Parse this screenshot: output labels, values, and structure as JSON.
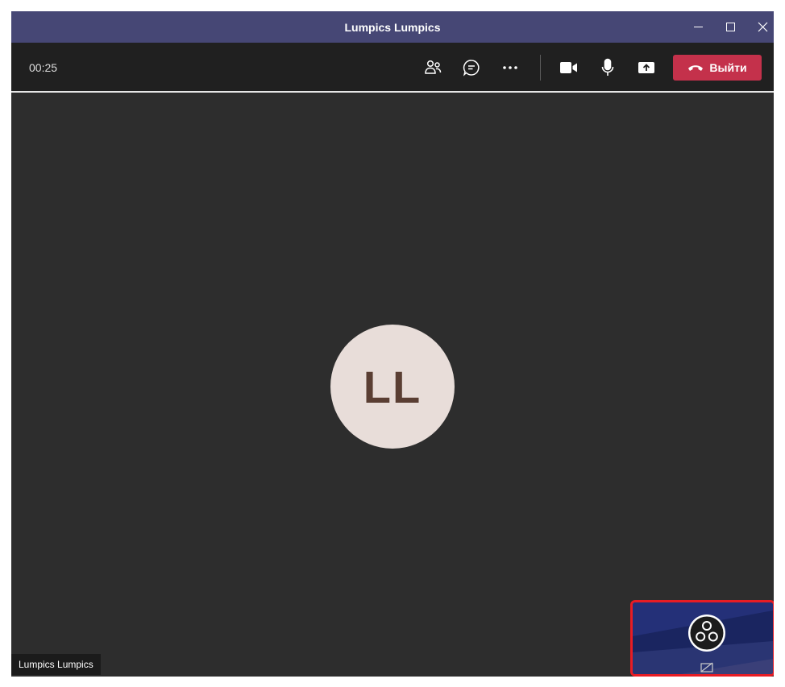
{
  "window": {
    "title": "Lumpics Lumpics"
  },
  "toolbar": {
    "timer": "00:25",
    "leave_label": "Выйти",
    "icons": {
      "participants": "people-icon",
      "chat": "chat-icon",
      "more": "more-options-icon",
      "camera": "video-camera-icon",
      "mic": "microphone-icon",
      "share": "share-screen-icon",
      "hangup": "phone-hangup-icon"
    }
  },
  "stage": {
    "avatar_initials": "LL",
    "name_tag": "Lumpics Lumpics",
    "self_view_logo": "obs-logo-icon",
    "self_view_status": "camera-off-icon"
  },
  "colors": {
    "titlebar": "#464775",
    "toolbar": "#202020",
    "stage": "#2d2d2d",
    "leave_button": "#c4314b",
    "avatar_bg": "#e8ddd9",
    "avatar_text": "#5a3e33",
    "highlight_border": "#e81c24"
  }
}
